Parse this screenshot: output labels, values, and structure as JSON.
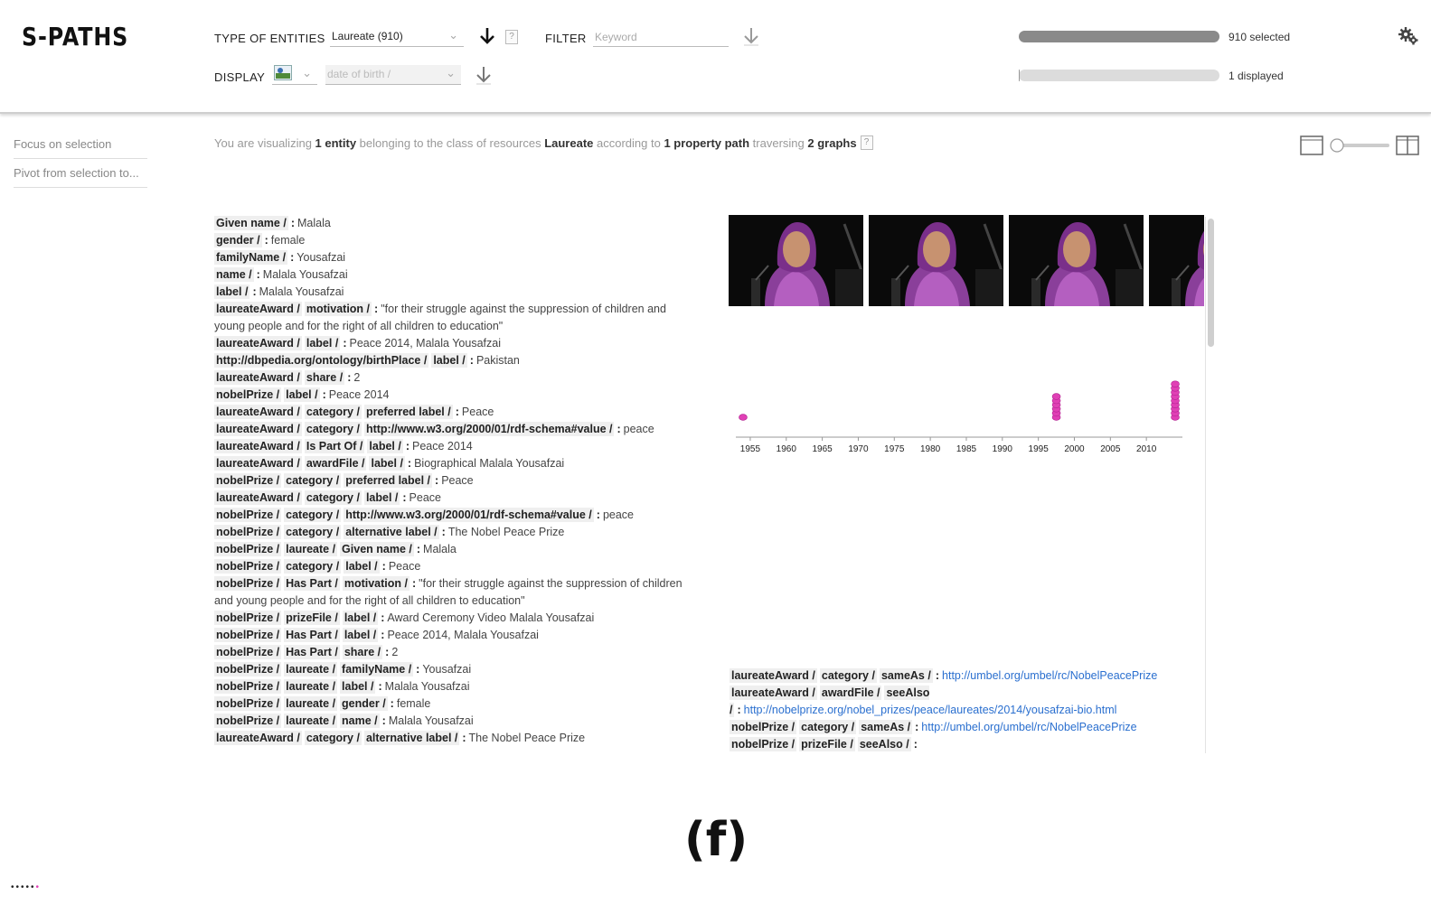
{
  "app": {
    "logo": "S-PATHS"
  },
  "toolbar": {
    "type_label": "TYPE OF ENTITIES",
    "type_value": "Laureate (910)",
    "display_label": "DISPLAY",
    "display_value": "date of birth /",
    "filter_label": "FILTER",
    "filter_placeholder": "Keyword",
    "help": "?",
    "selected_text": "910 selected",
    "displayed_text": "1 displayed",
    "selected_fraction": 1.0,
    "displayed_fraction": 0.0011
  },
  "sidebar": {
    "items": [
      {
        "label": "Focus on selection"
      },
      {
        "label": "Pivot from selection to..."
      }
    ]
  },
  "info": {
    "p1": "You are visualizing ",
    "b1": "1 entity",
    "p2": " belonging to the class of resources ",
    "b2": "Laureate",
    "p3": " according to ",
    "b3": "1 property path",
    "p4": " traversing ",
    "b4": "2 graphs",
    "help": "?"
  },
  "properties": [
    {
      "path": [
        "Given name /"
      ],
      "value": "Malala"
    },
    {
      "path": [
        "gender /"
      ],
      "value": "female"
    },
    {
      "path": [
        "familyName /"
      ],
      "value": "Yousafzai"
    },
    {
      "path": [
        "name /"
      ],
      "value": "Malala Yousafzai"
    },
    {
      "path": [
        "label /"
      ],
      "value": "Malala Yousafzai"
    },
    {
      "path": [
        "laureateAward /",
        "motivation /"
      ],
      "value": "\"for their struggle against the suppression of children and young people and for the right of all children to education\""
    },
    {
      "path": [
        "laureateAward /",
        "label /"
      ],
      "value": "Peace 2014, Malala Yousafzai"
    },
    {
      "path": [
        "http://dbpedia.org/ontology/birthPlace /",
        "label /"
      ],
      "value": "Pakistan"
    },
    {
      "path": [
        "laureateAward /",
        "share /"
      ],
      "value": "2"
    },
    {
      "path": [
        "nobelPrize /",
        "label /"
      ],
      "value": "Peace 2014"
    },
    {
      "path": [
        "laureateAward /",
        "category /",
        "preferred label /"
      ],
      "value": "Peace"
    },
    {
      "path": [
        "laureateAward /",
        "category /",
        "http://www.w3.org/2000/01/rdf-schema#value /"
      ],
      "value": "peace"
    },
    {
      "path": [
        "laureateAward /",
        "Is Part Of /",
        "label /"
      ],
      "value": "Peace 2014"
    },
    {
      "path": [
        "laureateAward /",
        "awardFile /",
        "label /"
      ],
      "value": "Biographical Malala Yousafzai"
    },
    {
      "path": [
        "nobelPrize /",
        "category /",
        "preferred label /"
      ],
      "value": "Peace"
    },
    {
      "path": [
        "laureateAward /",
        "category /",
        "label /"
      ],
      "value": "Peace"
    },
    {
      "path": [
        "nobelPrize /",
        "category /",
        "http://www.w3.org/2000/01/rdf-schema#value /"
      ],
      "value": "peace"
    },
    {
      "path": [
        "nobelPrize /",
        "category /",
        "alternative label /"
      ],
      "value": "The Nobel Peace Prize"
    },
    {
      "path": [
        "nobelPrize /",
        "laureate /",
        "Given name /"
      ],
      "value": "Malala"
    },
    {
      "path": [
        "nobelPrize /",
        "category /",
        "label /"
      ],
      "value": "Peace"
    },
    {
      "path": [
        "nobelPrize /",
        "Has Part /",
        "motivation /"
      ],
      "value": "\"for their struggle against the suppression of children and young people and for the right of all children to education\""
    },
    {
      "path": [
        "nobelPrize /",
        "prizeFile /",
        "label /"
      ],
      "value": "Award Ceremony Video Malala Yousafzai"
    },
    {
      "path": [
        "nobelPrize /",
        "Has Part /",
        "label /"
      ],
      "value": "Peace 2014, Malala Yousafzai"
    },
    {
      "path": [
        "nobelPrize /",
        "Has Part /",
        "share /"
      ],
      "value": "2"
    },
    {
      "path": [
        "nobelPrize /",
        "laureate /",
        "familyName /"
      ],
      "value": "Yousafzai"
    },
    {
      "path": [
        "nobelPrize /",
        "laureate /",
        "label /"
      ],
      "value": "Malala Yousafzai"
    },
    {
      "path": [
        "nobelPrize /",
        "laureate /",
        "gender /"
      ],
      "value": "female"
    },
    {
      "path": [
        "nobelPrize /",
        "laureate /",
        "name /"
      ],
      "value": "Malala Yousafzai"
    },
    {
      "path": [
        "laureateAward /",
        "category /",
        "alternative label /"
      ],
      "value": "The Nobel Peace Prize"
    }
  ],
  "link_properties": [
    {
      "path": [
        "laureateAward /",
        "category /",
        "sameAs /"
      ],
      "value": "http://umbel.org/umbel/rc/NobelPeacePrize"
    },
    {
      "path": [
        "laureateAward /",
        "awardFile /",
        "seeAlso /"
      ],
      "value": "http://nobelprize.org/nobel_prizes/peace/laureates/2014/yousafzai-bio.html"
    },
    {
      "path": [
        "nobelPrize /",
        "category /",
        "sameAs /"
      ],
      "value": "http://umbel.org/umbel/rc/NobelPeacePrize"
    },
    {
      "path": [
        "nobelPrize /",
        "prizeFile /",
        "seeAlso /"
      ],
      "value": ""
    }
  ],
  "chart_data": {
    "type": "scatter",
    "title": "",
    "xlabel": "",
    "ylabel": "",
    "xlim": [
      1953,
      2015
    ],
    "xticks": [
      1955,
      1960,
      1965,
      1970,
      1975,
      1980,
      1985,
      1990,
      1995,
      2000,
      2005,
      2010
    ],
    "series": [
      {
        "x": [
          1954,
          1997.5,
          2014
        ],
        "counts": [
          1,
          6,
          9
        ]
      }
    ],
    "color": "#e040b5",
    "grid": false
  },
  "figure_label": "(f)",
  "pager": {
    "dots": "•••••",
    "active_dot": "•"
  },
  "colors": {
    "accent": "#e040b5",
    "bar_selected": "#8a8a8a",
    "bar_displayed": "#d8d8d8",
    "link": "#2a6fcf"
  }
}
